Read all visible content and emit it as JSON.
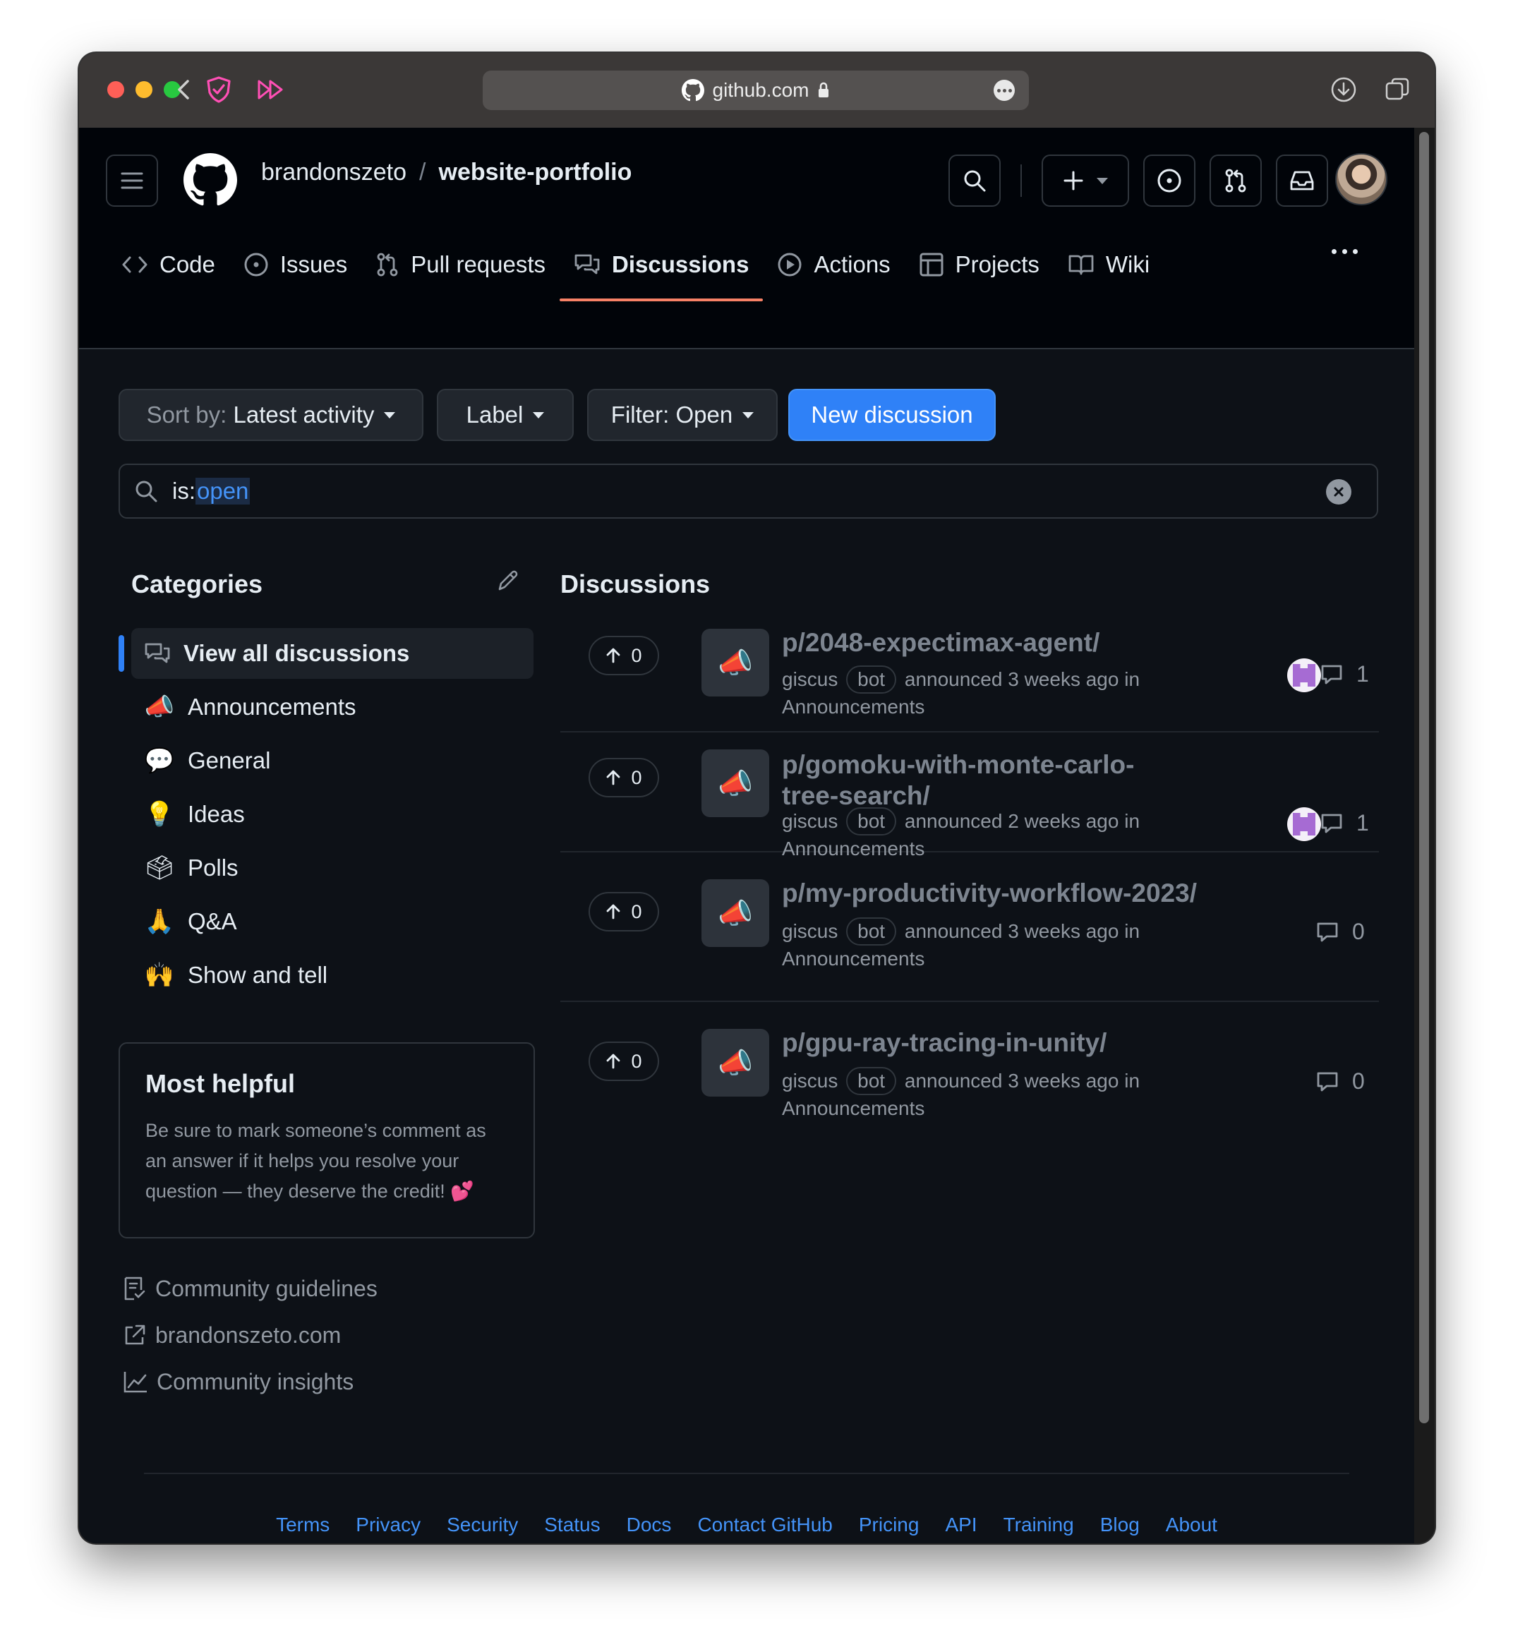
{
  "browser": {
    "url": "github.com",
    "colors": {
      "close": "#fe5f57",
      "minimize": "#febc2e",
      "zoom": "#28c840"
    }
  },
  "header": {
    "owner": "brandonszeto",
    "separator": "/",
    "repo": "website-portfolio"
  },
  "tabs": [
    {
      "label": "Code",
      "icon": "code-icon"
    },
    {
      "label": "Issues",
      "icon": "issue-icon"
    },
    {
      "label": "Pull requests",
      "icon": "pull-request-icon"
    },
    {
      "label": "Discussions",
      "icon": "discussion-icon",
      "active": true
    },
    {
      "label": "Actions",
      "icon": "play-icon"
    },
    {
      "label": "Projects",
      "icon": "table-icon"
    },
    {
      "label": "Wiki",
      "icon": "book-icon"
    }
  ],
  "toolbar": {
    "sort_prefix": "Sort by:",
    "sort_value": "Latest activity",
    "label": "Label",
    "filter": "Filter: Open",
    "new_discussion": "New discussion"
  },
  "search": {
    "query_key": "is:",
    "query_value": "open"
  },
  "categories": {
    "title": "Categories",
    "items": [
      {
        "label": "View all discussions",
        "emoji": "",
        "active": true
      },
      {
        "label": "Announcements",
        "emoji": "📣"
      },
      {
        "label": "General",
        "emoji": "💬"
      },
      {
        "label": "Ideas",
        "emoji": "💡"
      },
      {
        "label": "Polls",
        "emoji": "🗳"
      },
      {
        "label": "Q&A",
        "emoji": "🙏"
      },
      {
        "label": "Show and tell",
        "emoji": "🙌"
      }
    ]
  },
  "helpful": {
    "title": "Most helpful",
    "body": "Be sure to mark someone’s comment as an answer if it helps you resolve your question — they deserve the credit! 💕"
  },
  "side_links": [
    {
      "label": "Community guidelines",
      "icon": "guidelines-icon"
    },
    {
      "label": "brandonszeto.com",
      "icon": "external-link-icon"
    },
    {
      "label": "Community insights",
      "icon": "graph-icon"
    }
  ],
  "discussions": {
    "title": "Discussions",
    "items": [
      {
        "title": "p/2048-expectimax-agent/",
        "author": "giscus",
        "badge": "bot",
        "action": "announced 3 weeks ago in",
        "category": "Announcements",
        "votes": "0",
        "comments": "1",
        "has_participant": true
      },
      {
        "title": "p/gomoku-with-monte-carlo-tree-search/",
        "author": "giscus",
        "badge": "bot",
        "action": "announced 2 weeks ago in",
        "category": "Announcements",
        "votes": "0",
        "comments": "1",
        "has_participant": true
      },
      {
        "title": "p/my-productivity-workflow-2023/",
        "author": "giscus",
        "badge": "bot",
        "action": "announced 3 weeks ago in",
        "category": "Announcements",
        "votes": "0",
        "comments": "0",
        "has_participant": false
      },
      {
        "title": "p/gpu-ray-tracing-in-unity/",
        "author": "giscus",
        "badge": "bot",
        "action": "announced 3 weeks ago in",
        "category": "Announcements",
        "votes": "0",
        "comments": "0",
        "has_participant": false
      }
    ]
  },
  "footer": [
    "Terms",
    "Privacy",
    "Security",
    "Status",
    "Docs",
    "Contact GitHub",
    "Pricing",
    "API",
    "Training",
    "Blog",
    "About"
  ]
}
